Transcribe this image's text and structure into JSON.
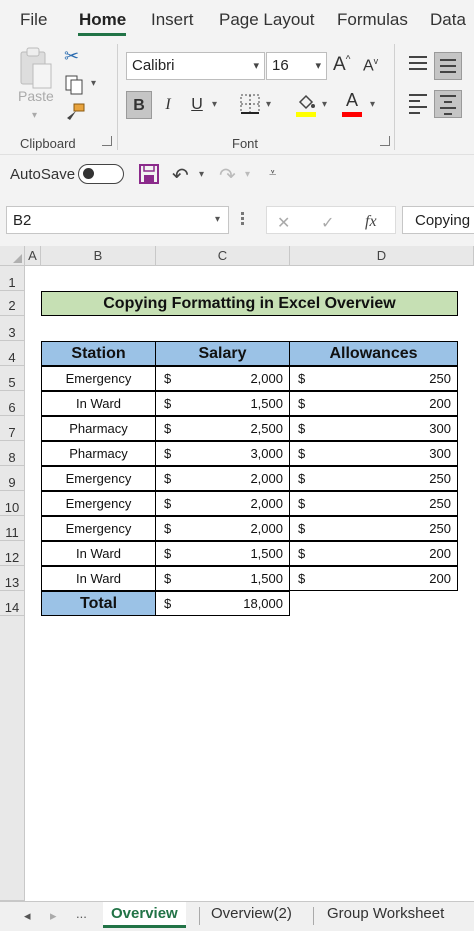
{
  "menu": {
    "tabs": [
      "File",
      "Home",
      "Insert",
      "Page Layout",
      "Formulas",
      "Data"
    ],
    "active": "Home"
  },
  "ribbon": {
    "clipboard": {
      "paste_label": "Paste",
      "group_label": "Clipboard"
    },
    "font": {
      "name": "Calibri",
      "size": "16",
      "group_label": "Font",
      "highlight_color": "#ffff00",
      "font_color": "#ff0000"
    }
  },
  "qat": {
    "autosave_label": "AutoSave"
  },
  "formula_bar": {
    "name_box": "B2",
    "content": "Copying"
  },
  "columns": [
    "A",
    "B",
    "C",
    "D"
  ],
  "rows": [
    "1",
    "2",
    "3",
    "4",
    "5",
    "6",
    "7",
    "8",
    "9",
    "10",
    "11",
    "12",
    "13",
    "14"
  ],
  "sheet": {
    "title": "Copying Formatting in Excel Overview",
    "headers": [
      "Station",
      "Salary",
      "Allowances"
    ],
    "currency": "$",
    "data": [
      {
        "station": "Emergency",
        "salary": "2,000",
        "allowance": "250"
      },
      {
        "station": "In Ward",
        "salary": "1,500",
        "allowance": "200"
      },
      {
        "station": "Pharmacy",
        "salary": "2,500",
        "allowance": "300"
      },
      {
        "station": "Pharmacy",
        "salary": "3,000",
        "allowance": "300"
      },
      {
        "station": "Emergency",
        "salary": "2,000",
        "allowance": "250"
      },
      {
        "station": "Emergency",
        "salary": "2,000",
        "allowance": "250"
      },
      {
        "station": "Emergency",
        "salary": "2,000",
        "allowance": "250"
      },
      {
        "station": "In Ward",
        "salary": "1,500",
        "allowance": "200"
      },
      {
        "station": "In Ward",
        "salary": "1,500",
        "allowance": "200"
      }
    ],
    "total_label": "Total",
    "total_salary": "18,000"
  },
  "sheet_tabs": {
    "ellipsis": "...",
    "tabs": [
      "Overview",
      "Overview(2)",
      "Group Worksheet"
    ],
    "active": "Overview"
  },
  "colors": {
    "accent": "#217346",
    "title_fill": "#c6e0b4",
    "header_fill": "#9bc2e6"
  }
}
